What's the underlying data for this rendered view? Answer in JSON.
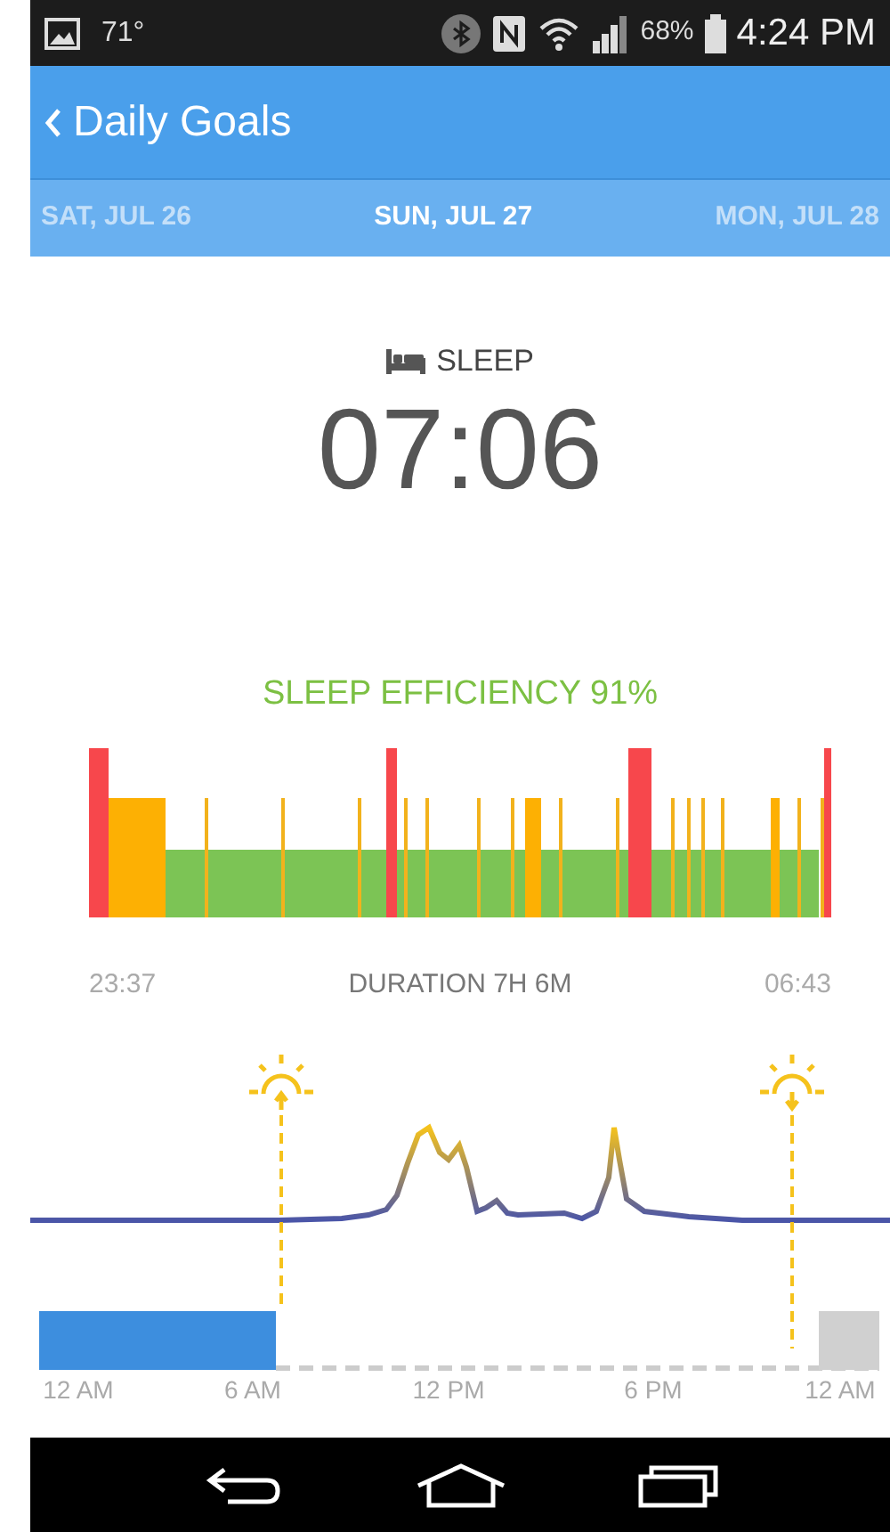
{
  "status_bar": {
    "temperature": "71°",
    "battery": "68%",
    "time": "4:24 PM"
  },
  "header": {
    "title": "Daily Goals"
  },
  "dates": [
    {
      "label": "SAT, JUL 26",
      "selected": false
    },
    {
      "label": "SUN, JUL 27",
      "selected": true
    },
    {
      "label": "MON, JUL 28",
      "selected": false
    }
  ],
  "metric": {
    "label": "SLEEP",
    "value": "07:06"
  },
  "efficiency": "SLEEP EFFICIENCY 91%",
  "sleep_range": {
    "start": "23:37",
    "duration": "DURATION 7H 6M",
    "end": "06:43"
  },
  "timeline": {
    "axis_labels": [
      "12 AM",
      "6 AM",
      "12 PM",
      "6 PM",
      "12 AM"
    ]
  }
}
